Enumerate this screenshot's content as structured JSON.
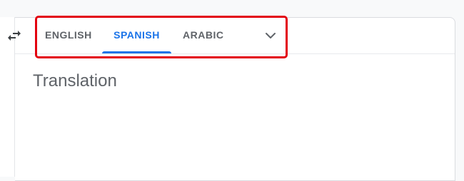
{
  "tabs": [
    {
      "label": "ENGLISH",
      "active": false
    },
    {
      "label": "SPANISH",
      "active": true
    },
    {
      "label": "ARABIC",
      "active": false
    }
  ],
  "more_languages_icon": "chevron-down-icon",
  "swap_icon": "swap-languages-icon",
  "output": {
    "placeholder": "Translation"
  },
  "colors": {
    "accent": "#1a73e8",
    "tab_text": "#5f6368",
    "highlight_box": "#e3000f",
    "placeholder_text": "#5f6368"
  }
}
